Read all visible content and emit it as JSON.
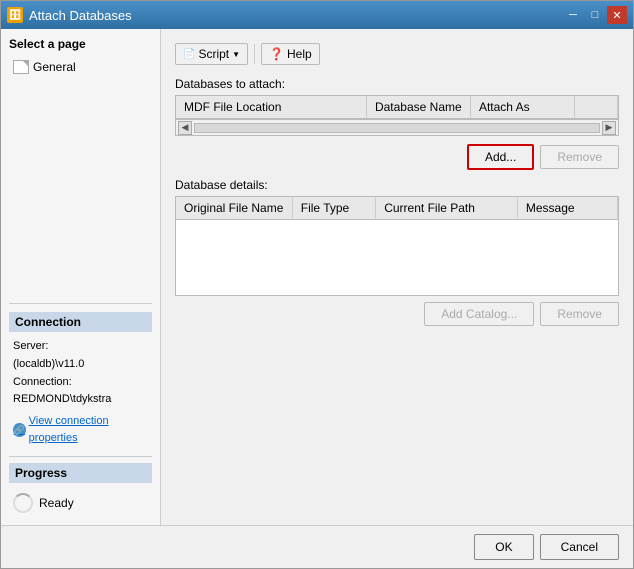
{
  "window": {
    "title": "Attach Databases",
    "icon": "🗄"
  },
  "titlebar": {
    "minimize_label": "─",
    "maximize_label": "□",
    "close_label": "✕"
  },
  "sidebar": {
    "select_page_label": "Select a page",
    "items": [
      {
        "id": "general",
        "label": "General"
      }
    ]
  },
  "toolbar": {
    "script_label": "Script",
    "help_label": "Help"
  },
  "databases_section": {
    "label": "Databases to attach:",
    "columns": [
      {
        "id": "mdf",
        "label": "MDF File Location"
      },
      {
        "id": "dbname",
        "label": "Database Name"
      },
      {
        "id": "attachas",
        "label": "Attach As"
      },
      {
        "id": "extra",
        "label": ""
      }
    ],
    "add_button": "Add...",
    "remove_button": "Remove"
  },
  "details_section": {
    "label": "Database details:",
    "columns": [
      {
        "id": "origname",
        "label": "Original File Name"
      },
      {
        "id": "filetype",
        "label": "File Type"
      },
      {
        "id": "currpath",
        "label": "Current File Path"
      },
      {
        "id": "message",
        "label": "Message"
      }
    ],
    "add_catalog_button": "Add Catalog...",
    "remove_button": "Remove"
  },
  "connection": {
    "section_label": "Connection",
    "server_label": "Server:",
    "server_value": "(localdb)\\v11.0",
    "connection_label": "Connection:",
    "connection_value": "REDMOND\\tdykstra",
    "link_label": "View connection properties"
  },
  "progress": {
    "section_label": "Progress",
    "status": "Ready"
  },
  "footer": {
    "ok_label": "OK",
    "cancel_label": "Cancel"
  }
}
